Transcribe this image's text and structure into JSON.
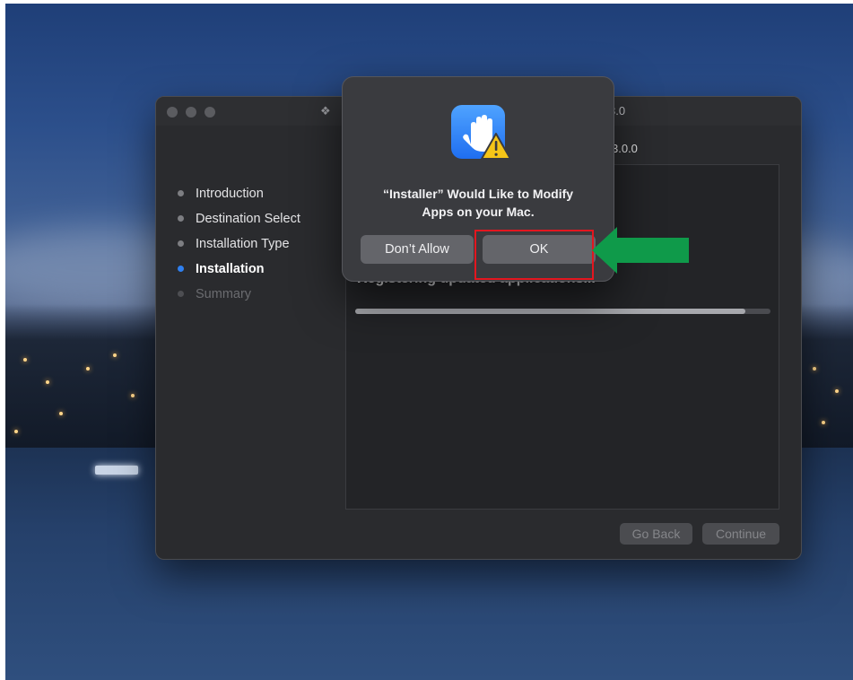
{
  "window": {
    "title_text": "3.0",
    "header_text": "3.0.0"
  },
  "steps": [
    {
      "label": "Introduction",
      "state": "done"
    },
    {
      "label": "Destination Select",
      "state": "done"
    },
    {
      "label": "Installation Type",
      "state": "done"
    },
    {
      "label": "Installation",
      "state": "active"
    },
    {
      "label": "Summary",
      "state": "pending"
    }
  ],
  "content": {
    "status_text": "Registering updated applications...",
    "progress": 0.94
  },
  "buttons": {
    "go_back": "Go Back",
    "continue": "Continue"
  },
  "dialog": {
    "title_line1": "“Installer” Would Like to Modify",
    "title_line2": "Apps on your Mac.",
    "dont_allow_label": "Don’t Allow",
    "ok_label": "OK",
    "icon": "hand-stop-warning-icon"
  },
  "annotation": {
    "highlight_color": "#e3161f",
    "arrow_color": "#0f9a4a"
  }
}
